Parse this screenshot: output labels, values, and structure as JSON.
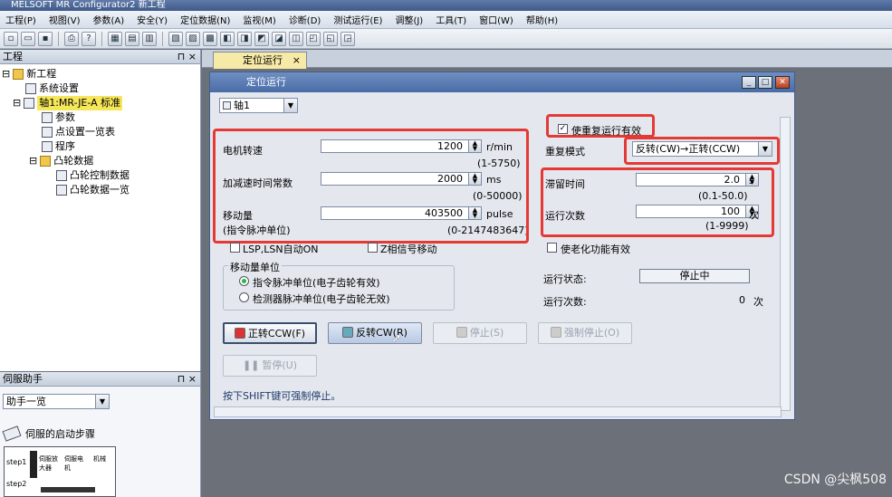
{
  "app": {
    "title": "MELSOFT MR Configurator2 新工程"
  },
  "menu": [
    "工程(P)",
    "视图(V)",
    "参数(A)",
    "安全(Y)",
    "定位数据(N)",
    "监视(M)",
    "诊断(D)",
    "测试运行(E)",
    "调整(J)",
    "工具(T)",
    "窗口(W)",
    "帮助(H)"
  ],
  "project_panel": {
    "title": "工程",
    "pin": "⊓",
    "close": "×",
    "tree": {
      "root": "新工程",
      "system": "系统设置",
      "axis": "轴1:MR-JE-A 标准",
      "param": "参数",
      "points": "点设置一览表",
      "program": "程序",
      "cam": "凸轮数据",
      "cam_ctrl": "凸轮控制数据",
      "cam_list": "凸轮数据一览"
    }
  },
  "helper_panel": {
    "title": "伺服助手",
    "pin": "⊓",
    "close": "×",
    "combo": "助手一览",
    "item": "伺服的启动步骤",
    "step1": "step1",
    "step2": "step2",
    "box1": "伺服放大器",
    "box2": "伺服电机",
    "box3": "机械"
  },
  "doc_tab": {
    "label": "定位运行",
    "close": "×"
  },
  "dialog": {
    "title": "定位运行",
    "axis_select": "轴1",
    "motor_speed": {
      "label": "电机转速",
      "value": "1200",
      "unit": "r/min",
      "range": "(1-5750)"
    },
    "accel_time": {
      "label": "加减速时间常数",
      "value": "2000",
      "unit": "ms",
      "range": "(0-50000)"
    },
    "travel": {
      "label": "移动量",
      "sub": "(指令脉冲单位)",
      "value": "403500",
      "unit": "pulse",
      "range": "(0-2147483647)"
    },
    "repeat_enable": {
      "label": "使重复运行有效",
      "checked": "✓"
    },
    "repeat_mode": {
      "label": "重复模式",
      "value": "反转(CW)→正转(CCW)"
    },
    "dwell": {
      "label": "滞留时间",
      "value": "2.0",
      "unit": "s",
      "range": "(0.1-50.0)"
    },
    "run_count": {
      "label": "运行次数",
      "value": "100",
      "unit": "次",
      "range": "(1-9999)"
    },
    "lsp_lsn": "LSP,LSN自动ON",
    "z_phase": "Z相信号移动",
    "aging": "使老化功能有效",
    "unit_group": {
      "title": "移动量单位",
      "opt1": "指令脉冲单位(电子齿轮有效)",
      "opt2": "检测器脉冲单位(电子齿轮无效)"
    },
    "status": {
      "label": "运行状态:",
      "value": "停止中"
    },
    "count": {
      "label": "运行次数:",
      "value": "0",
      "unit": "次"
    },
    "buttons": {
      "forward": "正转CCW(F)",
      "reverse": "反转CW(R)",
      "stop": "停止(S)",
      "force_stop": "强制停止(O)",
      "pause": "暂停(U)"
    },
    "hint": "按下SHIFT键可强制停止。"
  },
  "watermark": "CSDN @尖枫508",
  "colors": {
    "highlight_box": "#e53935",
    "title_blue": "#4a6ca6"
  }
}
